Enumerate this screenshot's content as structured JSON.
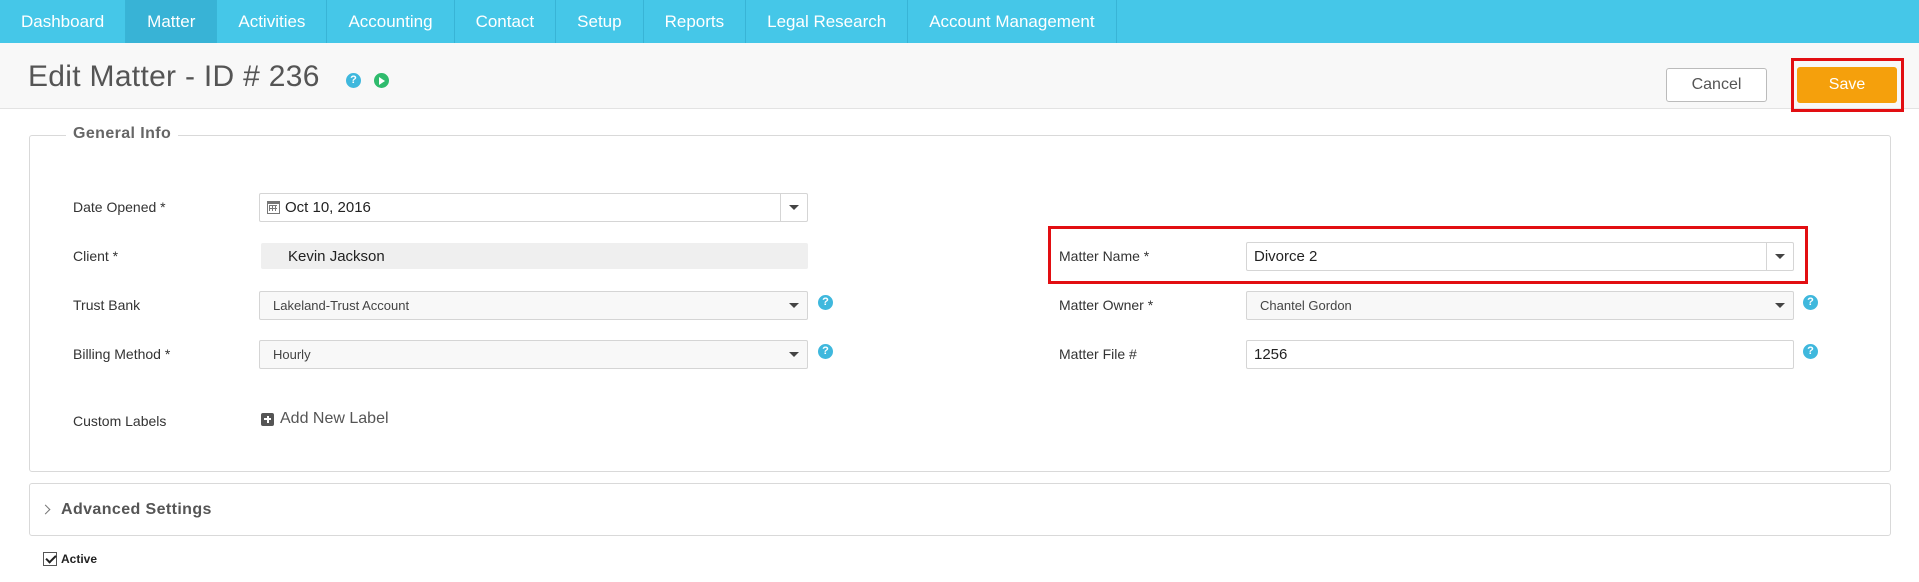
{
  "nav": {
    "items": [
      {
        "label": "Dashboard"
      },
      {
        "label": "Matter"
      },
      {
        "label": "Activities"
      },
      {
        "label": "Accounting"
      },
      {
        "label": "Contact"
      },
      {
        "label": "Setup"
      },
      {
        "label": "Reports"
      },
      {
        "label": "Legal Research"
      },
      {
        "label": "Account Management"
      }
    ],
    "active_index": 1
  },
  "header": {
    "title": "Edit Matter - ID # 236",
    "help_glyph": "?",
    "cancel_label": "Cancel",
    "save_label": "Save"
  },
  "general_info": {
    "legend": "General Info",
    "date_opened": {
      "label": "Date Opened *",
      "value": "Oct 10, 2016"
    },
    "client": {
      "label": "Client *",
      "value": "Kevin Jackson"
    },
    "trust_bank": {
      "label": "Trust Bank",
      "value": "Lakeland-Trust Account"
    },
    "billing_method": {
      "label": "Billing Method *",
      "value": "Hourly"
    },
    "custom_labels": {
      "label": "Custom Labels",
      "add_label": "Add New Label"
    },
    "matter_name": {
      "label": "Matter Name *",
      "value": "Divorce 2"
    },
    "matter_owner": {
      "label": "Matter Owner *",
      "value": "Chantel Gordon"
    },
    "matter_file": {
      "label": "Matter File #",
      "value": "1256"
    }
  },
  "advanced": {
    "label": "Advanced Settings"
  },
  "active": {
    "label": "Active",
    "checked": true
  },
  "colors": {
    "nav_bg": "#45c7e8",
    "nav_active": "#38b3d6",
    "save_button": "#f5a00c",
    "highlight": "#e20e12",
    "help_icon": "#3fb8dd",
    "play_icon": "#2fbb6d"
  },
  "icons": [
    "help-icon",
    "play-icon",
    "calendar-icon",
    "caret-down-icon",
    "plus-square-icon",
    "chevron-right-icon",
    "checkbox-check-icon"
  ]
}
